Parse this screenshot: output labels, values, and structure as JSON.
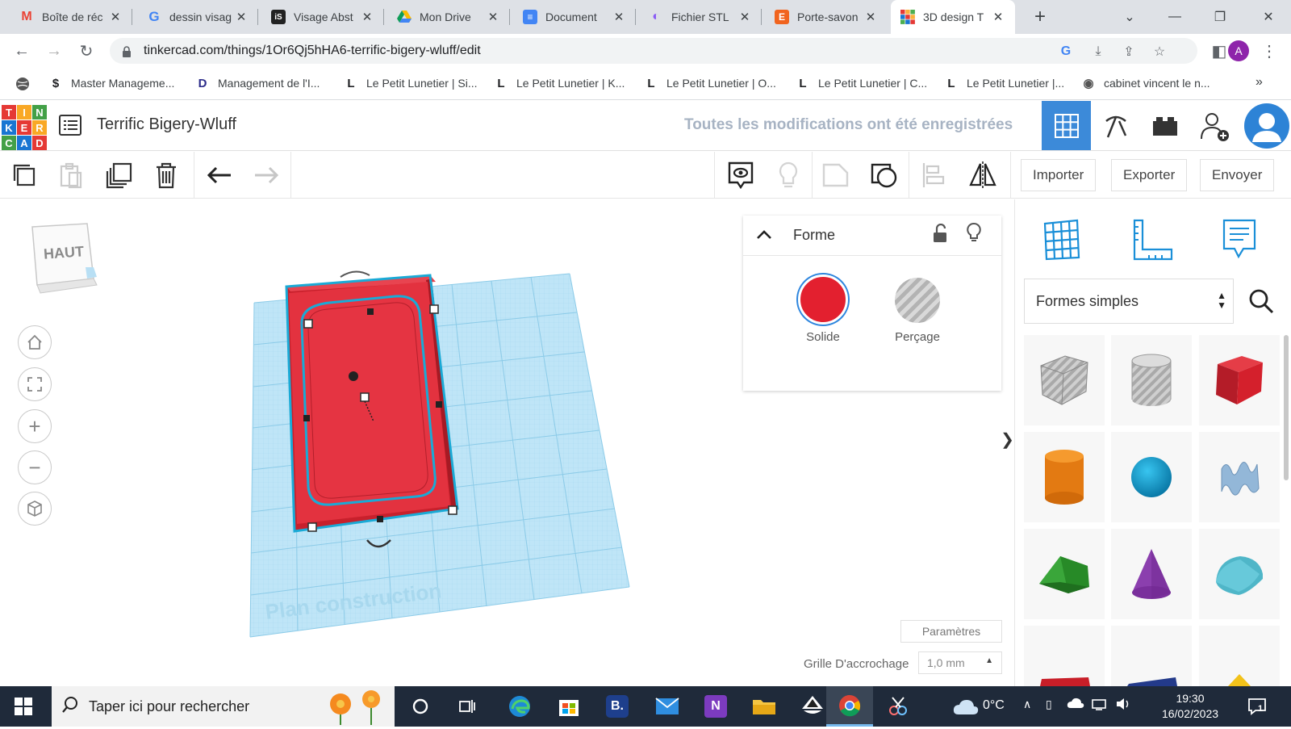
{
  "browser": {
    "tabs": [
      {
        "title": "Boîte de réc",
        "fav": "M",
        "favcolor": "#ea4335"
      },
      {
        "title": "dessin visag",
        "fav": "G",
        "favcolor": "#4285f4"
      },
      {
        "title": "Visage Abst",
        "fav": "iS",
        "favcolor": "#222222"
      },
      {
        "title": "Mon Drive",
        "fav": "▲",
        "favcolor": "#fbbc04"
      },
      {
        "title": "Document",
        "fav": "≡",
        "favcolor": "#4285f4"
      },
      {
        "title": "Fichier STL",
        "fav": "◐",
        "favcolor": "#8a5cf5"
      },
      {
        "title": "Porte-savon",
        "fav": "E",
        "favcolor": "#f1641e"
      },
      {
        "title": "3D design T",
        "fav": "T",
        "favcolor": "#e53935"
      }
    ],
    "new_tab": "+",
    "url": "tinkercad.com/things/1Or6Qj5hHA6-terrific-bigery-wluff/edit",
    "profile_initial": "A",
    "bookmarks": [
      {
        "label": "Master Manageme...",
        "icon": "$"
      },
      {
        "label": "Management de l'I...",
        "icon": "D"
      },
      {
        "label": "Le Petit Lunetier | Si...",
        "icon": "L"
      },
      {
        "label": "Le Petit Lunetier | K...",
        "icon": "L"
      },
      {
        "label": "Le Petit Lunetier | O...",
        "icon": "L"
      },
      {
        "label": "Le Petit Lunetier | C...",
        "icon": "L"
      },
      {
        "label": "Le Petit Lunetier |...",
        "icon": "L"
      },
      {
        "label": "cabinet vincent le n...",
        "icon": "◉"
      }
    ]
  },
  "tinkercad": {
    "logo_letters": [
      "T",
      "I",
      "N",
      "K",
      "E",
      "R",
      "C",
      "A",
      "D"
    ],
    "design_title": "Terrific Bigery-Wluff",
    "saved_status": "Toutes les modifications ont été enregistrées",
    "toolbar": {
      "import_label": "Importer",
      "export_label": "Exporter",
      "send_label": "Envoyer"
    },
    "view_cube_label": "HAUT",
    "workplane_label": "Plan construction",
    "forme_panel": {
      "title": "Forme",
      "solid_label": "Solide",
      "hole_label": "Perçage",
      "solid_color": "#e3202f"
    },
    "settings_label": "Paramètres",
    "snap_grid_label": "Grille D'accrochage",
    "snap_grid_value": "1,0 mm",
    "shapes_category": "Formes simples",
    "collapse_arrow": "❯"
  },
  "taskbar": {
    "search_placeholder": "Taper ici pour rechercher",
    "weather": "0°C",
    "time": "19:30",
    "date": "16/02/2023",
    "notifications": "1"
  }
}
